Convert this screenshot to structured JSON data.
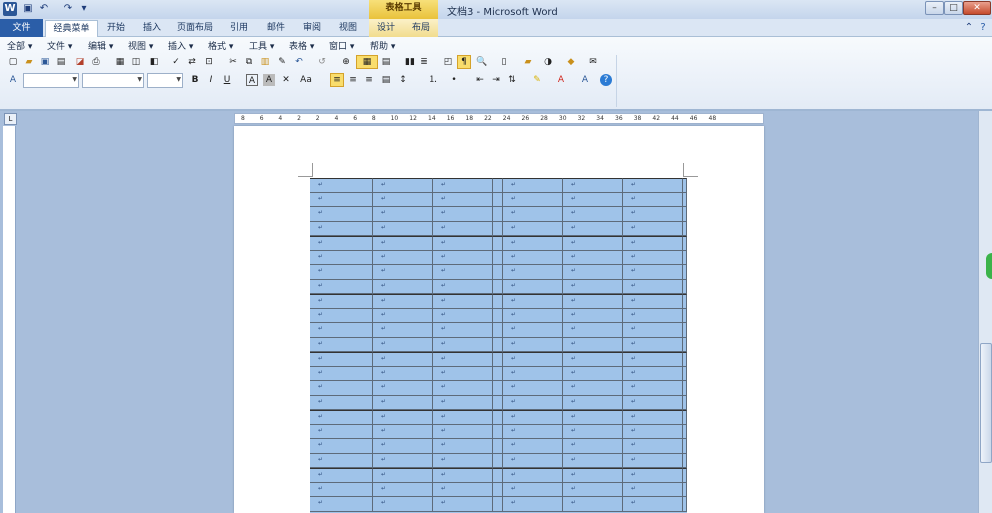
{
  "titlebar": {
    "app_letter": "W",
    "context_group": "表格工具",
    "document_title": "文档3 - Microsoft Word",
    "minimize": "–",
    "restore": "□",
    "close": "✕"
  },
  "tabs": {
    "file": "文件",
    "items": [
      "经典菜单",
      "开始",
      "插入",
      "页面布局",
      "引用",
      "邮件",
      "审阅",
      "视图",
      "设计",
      "布局"
    ]
  },
  "menubar": [
    "全部 ▾",
    "文件 ▾",
    "编辑 ▾",
    "视图 ▾",
    "插入 ▾",
    "格式 ▾",
    "工具 ▾",
    "表格 ▾",
    "窗口 ▾",
    "帮助 ▾"
  ],
  "toolbar": {
    "bold": "B",
    "italic": "I",
    "underline": "U",
    "font_name": "",
    "font_size": "",
    "style": ""
  },
  "ruler": {
    "h_ticks": [
      "8",
      "6",
      "4",
      "2",
      "2",
      "4",
      "6",
      "8",
      "10",
      "12",
      "14",
      "16",
      "18",
      "22",
      "24",
      "26",
      "28",
      "30",
      "32",
      "34",
      "36",
      "38",
      "42",
      "44",
      "46",
      "48"
    ]
  },
  "table": {
    "cell_mark": "↵",
    "rows": 23
  },
  "colors": {
    "file_tab": "#2b5ea8",
    "context_tab": "#e9c23b",
    "table_fill": "#9fc3e9",
    "accent_green": "#3bb34a"
  }
}
